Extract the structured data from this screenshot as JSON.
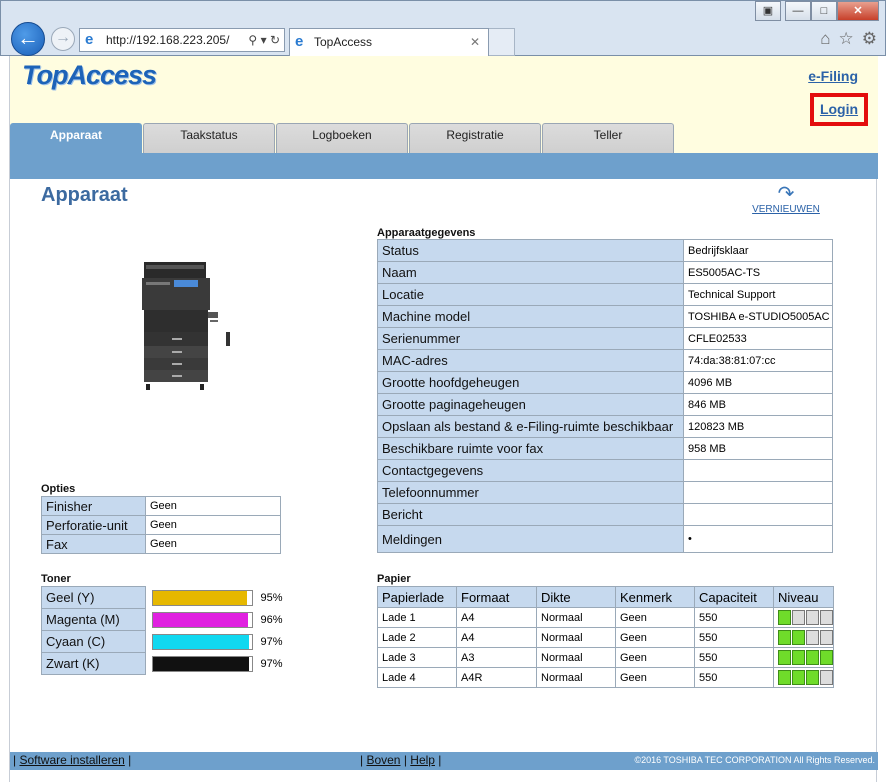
{
  "browser": {
    "url": "http://192.168.223.205/",
    "tab_title": "TopAccess",
    "icons": [
      "back-arrow-icon",
      "forward-arrow-icon",
      "ie-icon",
      "search-icon",
      "dropdown-icon",
      "refresh-icon",
      "close-icon",
      "home-icon",
      "star-icon",
      "gear-icon"
    ]
  },
  "header": {
    "logo": "TopAccess",
    "efiling": "e-Filing",
    "login": "Login"
  },
  "nav": {
    "tabs": [
      "Apparaat",
      "Taakstatus",
      "Logboeken",
      "Registratie",
      "Teller"
    ]
  },
  "page": {
    "title": "Apparaat",
    "refresh": "VERNIEUWEN"
  },
  "device": {
    "section": "Apparaatgegevens",
    "rows": [
      {
        "label": "Status",
        "value": "Bedrijfsklaar"
      },
      {
        "label": "Naam",
        "value": "ES5005AC-TS"
      },
      {
        "label": "Locatie",
        "value": "Technical Support"
      },
      {
        "label": "Machine model",
        "value": "TOSHIBA e-STUDIO5005AC"
      },
      {
        "label": "Serienummer",
        "value": "CFLE02533"
      },
      {
        "label": "MAC-adres",
        "value": "74:da:38:81:07:cc"
      },
      {
        "label": "Grootte hoofdgeheugen",
        "value": "4096 MB"
      },
      {
        "label": "Grootte paginageheugen",
        "value": "846 MB"
      },
      {
        "label": "Opslaan als bestand & e-Filing-ruimte beschikbaar",
        "value": "120823 MB"
      },
      {
        "label": "Beschikbare ruimte voor fax",
        "value": "958 MB"
      },
      {
        "label": "Contactgegevens",
        "value": ""
      },
      {
        "label": "Telefoonnummer",
        "value": ""
      },
      {
        "label": "Bericht",
        "value": ""
      },
      {
        "label": "Meldingen",
        "value": "•"
      }
    ]
  },
  "options": {
    "section": "Opties",
    "rows": [
      {
        "label": "Finisher",
        "value": "Geen"
      },
      {
        "label": "Perforatie-unit",
        "value": "Geen"
      },
      {
        "label": "Fax",
        "value": "Geen"
      }
    ]
  },
  "toner": {
    "section": "Toner",
    "rows": [
      {
        "label": "Geel (Y)",
        "pct": "95%",
        "level": 95,
        "color": "#e6b800"
      },
      {
        "label": "Magenta (M)",
        "pct": "96%",
        "level": 96,
        "color": "#e020e0"
      },
      {
        "label": "Cyaan (C)",
        "pct": "97%",
        "level": 97,
        "color": "#10d8f0"
      },
      {
        "label": "Zwart (K)",
        "pct": "97%",
        "level": 97,
        "color": "#111111"
      }
    ]
  },
  "paper": {
    "section": "Papier",
    "headers": [
      "Papierlade",
      "Formaat",
      "Dikte",
      "Kenmerk",
      "Capaciteit",
      "Niveau"
    ],
    "rows": [
      {
        "lade": "Lade 1",
        "formaat": "A4",
        "dikte": "Normaal",
        "kenmerk": "Geen",
        "capaciteit": "550",
        "level": 1
      },
      {
        "lade": "Lade 2",
        "formaat": "A4",
        "dikte": "Normaal",
        "kenmerk": "Geen",
        "capaciteit": "550",
        "level": 2
      },
      {
        "lade": "Lade 3",
        "formaat": "A3",
        "dikte": "Normaal",
        "kenmerk": "Geen",
        "capaciteit": "550",
        "level": 4
      },
      {
        "lade": "Lade 4",
        "formaat": "A4R",
        "dikte": "Normaal",
        "kenmerk": "Geen",
        "capaciteit": "550",
        "level": 3
      }
    ]
  },
  "footer": {
    "install": "Software installeren",
    "boven": "Boven",
    "help": "Help",
    "copyright": "©2016 TOSHIBA TEC CORPORATION All Rights Reserved."
  }
}
